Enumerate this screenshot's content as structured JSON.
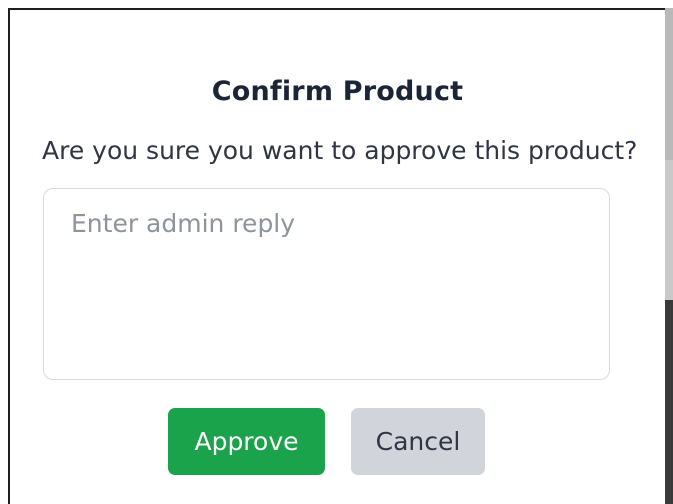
{
  "dialog": {
    "title": "Confirm Product",
    "question": "Are you sure you want to approve this product?",
    "reply": {
      "value": "",
      "placeholder": "Enter admin reply"
    },
    "approve_label": "Approve",
    "cancel_label": "Cancel"
  },
  "colors": {
    "approve_bg": "#1aa34a",
    "cancel_bg": "#d1d5db",
    "title_text": "#1c2536"
  }
}
